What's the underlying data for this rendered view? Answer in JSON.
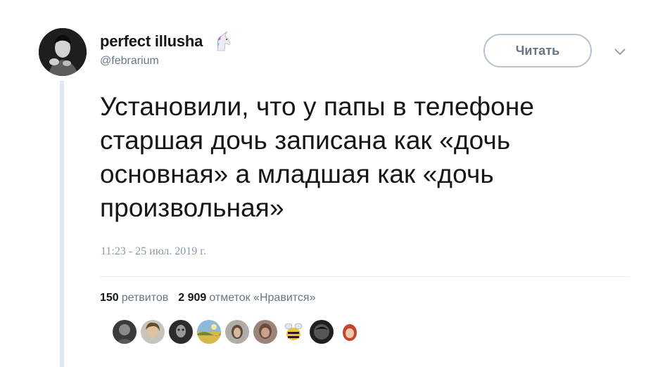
{
  "author": {
    "display_name": "perfect illusha",
    "handle": "@febrarium",
    "emoji_icon": "unicorn-icon"
  },
  "follow_button": {
    "label": "Читать"
  },
  "tweet": {
    "text": "Установили, что у папы в телефоне старшая дочь записана как «дочь основная» а младшая как «дочь произвольная»",
    "timestamp": "11:23 - 25 июл. 2019 г."
  },
  "stats": {
    "retweets_count": "150",
    "retweets_label": "ретвитов",
    "likes_count": "2 909",
    "likes_label": "отметок «Нравится»"
  },
  "colors": {
    "text": "#14171a",
    "secondary": "#657786",
    "border": "#e1e8ed"
  }
}
